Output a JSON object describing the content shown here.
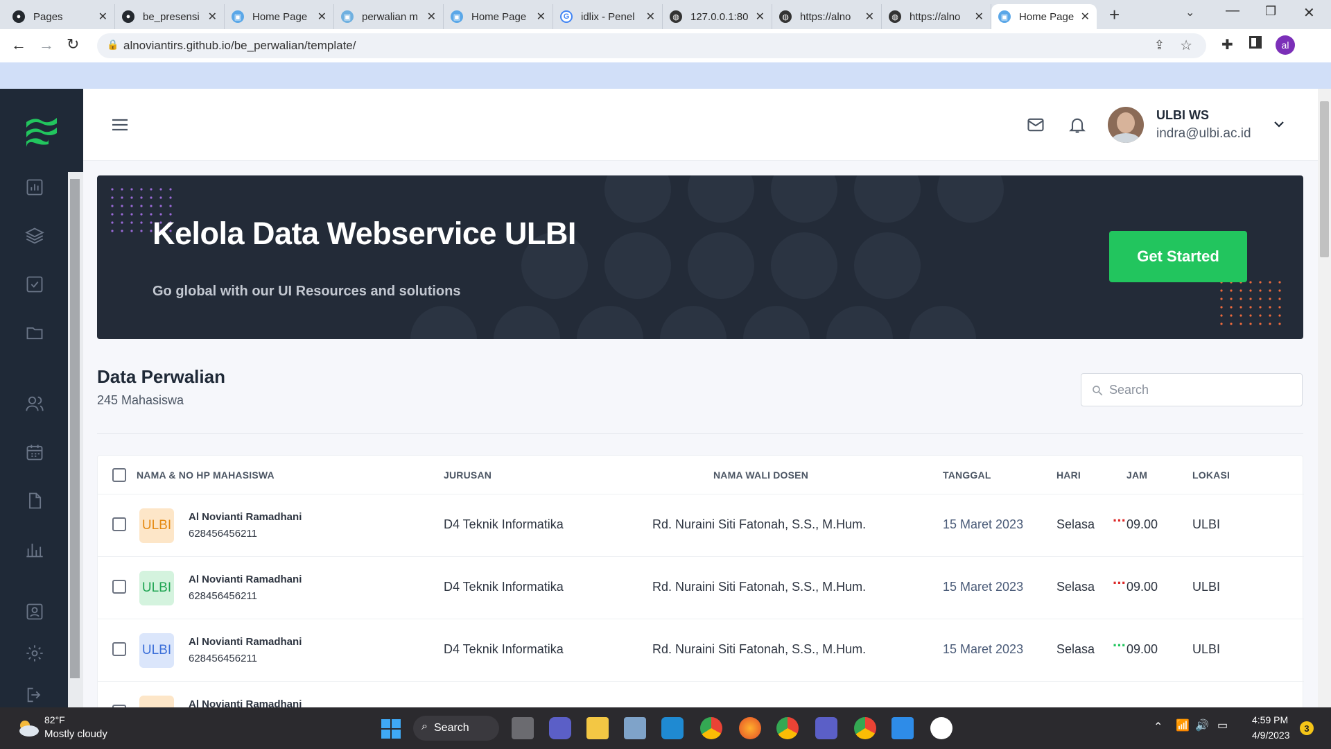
{
  "browser": {
    "tabs": [
      {
        "title": "Pages",
        "icon": "github-icon"
      },
      {
        "title": "be_presensi",
        "icon": "github-icon"
      },
      {
        "title": "Home Page",
        "icon": "page-icon"
      },
      {
        "title": "perwalian m",
        "icon": "page-icon"
      },
      {
        "title": "Home Page",
        "icon": "page-icon"
      },
      {
        "title": "idlix - Penel",
        "icon": "google-icon"
      },
      {
        "title": "127.0.0.1:80",
        "icon": "globe-icon"
      },
      {
        "title": "https://alno",
        "icon": "globe-icon"
      },
      {
        "title": "https://alno",
        "icon": "globe-icon"
      },
      {
        "title": "Home Page",
        "icon": "page-icon"
      }
    ],
    "url": "alnoviantirs.github.io/be_perwalian/template/",
    "profile_initials": "al"
  },
  "header": {
    "user_name": "ULBI WS",
    "user_email": "indra@ulbi.ac.id"
  },
  "banner": {
    "title": "Kelola Data Webservice ULBI",
    "subtitle": "Go global with our UI Resources and solutions",
    "button_label": "Get Started"
  },
  "section": {
    "title": "Data Perwalian",
    "count_label": "245 Mahasiswa",
    "search_placeholder": "Search"
  },
  "table": {
    "headers": {
      "name": "NAMA & NO HP MAHASISWA",
      "jurusan": "JURUSAN",
      "dosen": "NAMA WALI DOSEN",
      "tanggal": "TANGGAL",
      "hari": "HARI",
      "jam": "JAM",
      "lokasi": "LOKASI"
    },
    "rows": [
      {
        "badge": "ULBI",
        "name": "Al Novianti Ramadhani",
        "phone": "628456456211",
        "jurusan": "D4 Teknik Informatika",
        "dosen": "Rd. Nuraini Siti Fatonah, S.S., M.Hum.",
        "tanggal": "15 Maret 2023",
        "hari": "Selasa",
        "jam": "09.00",
        "lokasi": "ULBI",
        "actions": "···"
      },
      {
        "badge": "ULBI",
        "name": "Al Novianti Ramadhani",
        "phone": "628456456211",
        "jurusan": "D4 Teknik Informatika",
        "dosen": "Rd. Nuraini Siti Fatonah, S.S., M.Hum.",
        "tanggal": "15 Maret 2023",
        "hari": "Selasa",
        "jam": "09.00",
        "lokasi": "ULBI",
        "actions": "···"
      },
      {
        "badge": "ULBI",
        "name": "Al Novianti Ramadhani",
        "phone": "628456456211",
        "jurusan": "D4 Teknik Informatika",
        "dosen": "Rd. Nuraini Siti Fatonah, S.S., M.Hum.",
        "tanggal": "15 Maret 2023",
        "hari": "Selasa",
        "jam": "09.00",
        "lokasi": "ULBI",
        "actions": "···"
      },
      {
        "badge": "",
        "name": "Al Novianti Ramadhani",
        "phone": "",
        "jurusan": "",
        "dosen": "",
        "tanggal": "",
        "hari": "",
        "jam": "",
        "lokasi": "",
        "actions": ""
      }
    ]
  },
  "colors": {
    "accent": "#22c55e",
    "sidebar": "#1f2937",
    "banner": "#232b38",
    "date": "#4a5b78",
    "badge_orange_bg": "#fde6c8",
    "badge_orange_fg": "#e58a12",
    "badge_green_bg": "#d4f3de",
    "badge_green_fg": "#20a553",
    "badge_blue_bg": "#dbe6fb",
    "badge_blue_fg": "#3b6fd9",
    "dots_red": "#dc2626",
    "dots_green": "#22c55e"
  },
  "taskbar": {
    "weather_temp": "82°F",
    "weather_desc": "Mostly cloudy",
    "search_label": "Search",
    "time": "4:59 PM",
    "date": "4/9/2023",
    "notification_count": "3"
  }
}
